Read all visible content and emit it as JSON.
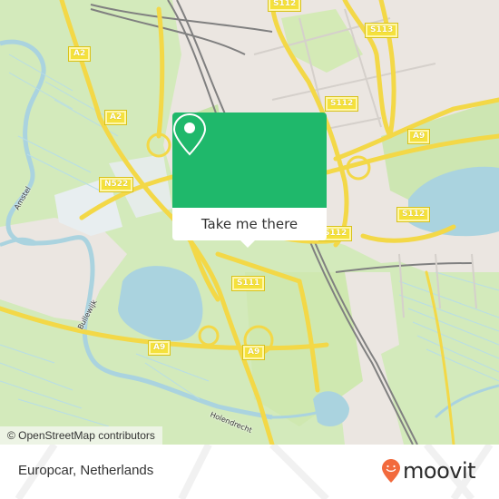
{
  "map": {
    "attribution": "© OpenStreetMap contributors",
    "road_labels": [
      {
        "id": "a2-north",
        "text": "A2"
      },
      {
        "id": "a2-south",
        "text": "A2"
      },
      {
        "id": "n522",
        "text": "N522"
      },
      {
        "id": "s112-top",
        "text": "S112"
      },
      {
        "id": "s113",
        "text": "S113"
      },
      {
        "id": "s112-mid",
        "text": "S112"
      },
      {
        "id": "a9-east",
        "text": "A9"
      },
      {
        "id": "s112-east",
        "text": "S112"
      },
      {
        "id": "s112-center",
        "text": "S112"
      },
      {
        "id": "s111",
        "text": "S111"
      },
      {
        "id": "a9-west",
        "text": "A9"
      },
      {
        "id": "a9-center",
        "text": "A9"
      }
    ],
    "water_labels": [
      {
        "id": "amstel",
        "text": "Amstel"
      },
      {
        "id": "bullewijk",
        "text": "Bullewijk"
      },
      {
        "id": "holendrecht",
        "text": "Holendrecht"
      }
    ],
    "colors": {
      "land_green": "#cfe8b4",
      "urban": "#ebe6e1",
      "water": "#aad3df",
      "motorway": "#f7e04b",
      "rail": "#777777"
    }
  },
  "popup": {
    "icon": "map-pin-icon",
    "button_label": "Take me there",
    "accent_color": "#1fb86b"
  },
  "footer": {
    "place_name": "Europcar, Netherlands",
    "brand": "moovit",
    "brand_color": "#f26a3d"
  }
}
